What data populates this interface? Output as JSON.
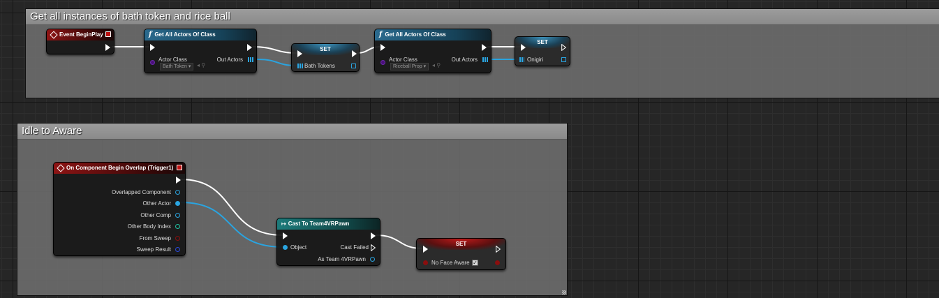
{
  "comments": {
    "bath_rice": {
      "title": "Get all instances of bath token and rice ball"
    },
    "idle_aware": {
      "title": "Idle to Aware"
    }
  },
  "nodes": {
    "event_begin_play": {
      "title": "Event BeginPlay"
    },
    "get_actors_1": {
      "title": "Get All Actors Of Class",
      "actor_class_label": "Actor Class",
      "actor_class_value": "Bath Token",
      "out_label": "Out Actors"
    },
    "set_bath_tokens": {
      "title": "SET",
      "var": "Bath Tokens"
    },
    "get_actors_2": {
      "title": "Get All Actors Of Class",
      "actor_class_label": "Actor Class",
      "actor_class_value": "Riceball Prop",
      "out_label": "Out Actors"
    },
    "set_onigiri": {
      "title": "SET",
      "var": "Onigiri"
    },
    "overlap_event": {
      "title": "On Component Begin Overlap (Trigger1)",
      "pins": [
        "Overlapped Component",
        "Other Actor",
        "Other Comp",
        "Other Body Index",
        "From Sweep",
        "Sweep Result"
      ]
    },
    "cast_node": {
      "title": "Cast To Team4VRPawn",
      "object_label": "Object",
      "cast_failed": "Cast Failed",
      "as_label": "As Team 4VRPawn"
    },
    "set_no_face": {
      "title": "SET",
      "var": "No Face Aware",
      "checked": true
    }
  },
  "colors": {
    "exec": "#ffffff",
    "object_pin": "#2aa4e0",
    "bool_pin": "#8a0e0e",
    "class_pin": "#4a0f7a",
    "event_header": "#8e1414",
    "function_header": "#2a6a8e",
    "cast_header": "#1d7b7b"
  }
}
